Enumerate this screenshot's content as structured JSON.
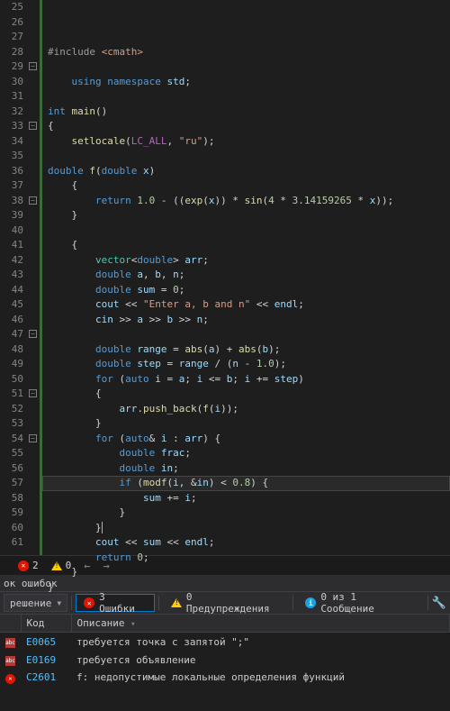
{
  "editor": {
    "first_line": 25,
    "lines": [
      {
        "n": 25,
        "seg": [
          {
            "c": "tok-pp",
            "t": "#include "
          },
          {
            "c": "tok-str",
            "t": "<cmath>"
          }
        ]
      },
      {
        "n": 26,
        "seg": []
      },
      {
        "n": 27,
        "seg": [
          {
            "c": "tok-kw",
            "t": "    using "
          },
          {
            "c": "tok-kw",
            "t": "namespace "
          },
          {
            "c": "tok-var",
            "t": "std"
          },
          {
            "c": "",
            "t": ";"
          }
        ]
      },
      {
        "n": 28,
        "seg": []
      },
      {
        "n": 29,
        "fold": "-",
        "seg": [
          {
            "c": "tok-type",
            "t": "int "
          },
          {
            "c": "tok-fn",
            "t": "main"
          },
          {
            "c": "",
            "t": "()"
          }
        ]
      },
      {
        "n": 30,
        "seg": [
          {
            "c": "",
            "t": "{"
          }
        ]
      },
      {
        "n": 31,
        "seg": [
          {
            "c": "",
            "t": "    "
          },
          {
            "c": "tok-fn",
            "t": "setlocale"
          },
          {
            "c": "",
            "t": "("
          },
          {
            "c": "tok-mac",
            "t": "LC_ALL"
          },
          {
            "c": "",
            "t": ", "
          },
          {
            "c": "tok-str",
            "t": "\"ru\""
          },
          {
            "c": "",
            "t": ");"
          }
        ]
      },
      {
        "n": 32,
        "seg": []
      },
      {
        "n": 33,
        "fold": "-",
        "seg": [
          {
            "c": "tok-type",
            "t": "double "
          },
          {
            "c": "tok-fn",
            "t": "f"
          },
          {
            "c": "",
            "t": "("
          },
          {
            "c": "tok-type",
            "t": "double "
          },
          {
            "c": "tok-var",
            "t": "x"
          },
          {
            "c": "",
            "t": ")"
          }
        ]
      },
      {
        "n": 34,
        "seg": [
          {
            "c": "",
            "t": "    {"
          }
        ]
      },
      {
        "n": 35,
        "seg": [
          {
            "c": "",
            "t": "        "
          },
          {
            "c": "tok-kw",
            "t": "return "
          },
          {
            "c": "tok-num",
            "t": "1.0"
          },
          {
            "c": "",
            "t": " - (("
          },
          {
            "c": "tok-fn",
            "t": "exp"
          },
          {
            "c": "",
            "t": "("
          },
          {
            "c": "tok-var",
            "t": "x"
          },
          {
            "c": "",
            "t": ")) * "
          },
          {
            "c": "tok-fn",
            "t": "sin"
          },
          {
            "c": "",
            "t": "("
          },
          {
            "c": "tok-num",
            "t": "4"
          },
          {
            "c": "",
            "t": " * "
          },
          {
            "c": "tok-num",
            "t": "3.14159265"
          },
          {
            "c": "",
            "t": " * "
          },
          {
            "c": "tok-var",
            "t": "x"
          },
          {
            "c": "",
            "t": "));"
          }
        ]
      },
      {
        "n": 36,
        "seg": [
          {
            "c": "",
            "t": "    }"
          }
        ]
      },
      {
        "n": 37,
        "seg": []
      },
      {
        "n": 38,
        "fold": "-",
        "seg": [
          {
            "c": "",
            "t": "    {"
          }
        ]
      },
      {
        "n": 39,
        "seg": [
          {
            "c": "",
            "t": "        "
          },
          {
            "c": "tok-utype",
            "t": "vector"
          },
          {
            "c": "",
            "t": "<"
          },
          {
            "c": "tok-type",
            "t": "double"
          },
          {
            "c": "",
            "t": "> "
          },
          {
            "c": "tok-var",
            "t": "arr"
          },
          {
            "c": "",
            "t": ";"
          }
        ]
      },
      {
        "n": 40,
        "seg": [
          {
            "c": "",
            "t": "        "
          },
          {
            "c": "tok-type",
            "t": "double "
          },
          {
            "c": "tok-var",
            "t": "a"
          },
          {
            "c": "",
            "t": ", "
          },
          {
            "c": "tok-var",
            "t": "b"
          },
          {
            "c": "",
            "t": ", "
          },
          {
            "c": "tok-var",
            "t": "n"
          },
          {
            "c": "",
            "t": ";"
          }
        ]
      },
      {
        "n": 41,
        "seg": [
          {
            "c": "",
            "t": "        "
          },
          {
            "c": "tok-type",
            "t": "double "
          },
          {
            "c": "tok-var",
            "t": "sum"
          },
          {
            "c": "",
            "t": " = "
          },
          {
            "c": "tok-num",
            "t": "0"
          },
          {
            "c": "",
            "t": ";"
          }
        ]
      },
      {
        "n": 42,
        "seg": [
          {
            "c": "",
            "t": "        "
          },
          {
            "c": "tok-var",
            "t": "cout"
          },
          {
            "c": "",
            "t": " << "
          },
          {
            "c": "tok-str",
            "t": "\"Enter a, b and n\""
          },
          {
            "c": "",
            "t": " << "
          },
          {
            "c": "tok-var",
            "t": "endl"
          },
          {
            "c": "",
            "t": ";"
          }
        ]
      },
      {
        "n": 43,
        "seg": [
          {
            "c": "",
            "t": "        "
          },
          {
            "c": "tok-var",
            "t": "cin"
          },
          {
            "c": "",
            "t": " >> "
          },
          {
            "c": "tok-var",
            "t": "a"
          },
          {
            "c": "",
            "t": " >> "
          },
          {
            "c": "tok-var",
            "t": "b"
          },
          {
            "c": "",
            "t": " >> "
          },
          {
            "c": "tok-var",
            "t": "n"
          },
          {
            "c": "",
            "t": ";"
          }
        ]
      },
      {
        "n": 44,
        "seg": []
      },
      {
        "n": 45,
        "seg": [
          {
            "c": "",
            "t": "        "
          },
          {
            "c": "tok-type",
            "t": "double "
          },
          {
            "c": "tok-var",
            "t": "range"
          },
          {
            "c": "",
            "t": " = "
          },
          {
            "c": "tok-fn",
            "t": "abs"
          },
          {
            "c": "",
            "t": "("
          },
          {
            "c": "tok-var",
            "t": "a"
          },
          {
            "c": "",
            "t": ") + "
          },
          {
            "c": "tok-fn",
            "t": "abs"
          },
          {
            "c": "",
            "t": "("
          },
          {
            "c": "tok-var",
            "t": "b"
          },
          {
            "c": "",
            "t": ");"
          }
        ]
      },
      {
        "n": 46,
        "seg": [
          {
            "c": "",
            "t": "        "
          },
          {
            "c": "tok-type",
            "t": "double "
          },
          {
            "c": "tok-var",
            "t": "step"
          },
          {
            "c": "",
            "t": " = "
          },
          {
            "c": "tok-var",
            "t": "range"
          },
          {
            "c": "",
            "t": " / ("
          },
          {
            "c": "tok-var",
            "t": "n"
          },
          {
            "c": "",
            "t": " - "
          },
          {
            "c": "tok-num",
            "t": "1.0"
          },
          {
            "c": "",
            "t": ");"
          }
        ]
      },
      {
        "n": 47,
        "fold": "-",
        "seg": [
          {
            "c": "",
            "t": "        "
          },
          {
            "c": "tok-kw",
            "t": "for "
          },
          {
            "c": "",
            "t": "("
          },
          {
            "c": "tok-kw",
            "t": "auto "
          },
          {
            "c": "tok-var",
            "t": "i"
          },
          {
            "c": "",
            "t": " = "
          },
          {
            "c": "tok-var",
            "t": "a"
          },
          {
            "c": "",
            "t": "; "
          },
          {
            "c": "tok-var",
            "t": "i"
          },
          {
            "c": "",
            "t": " <= "
          },
          {
            "c": "tok-var",
            "t": "b"
          },
          {
            "c": "",
            "t": "; "
          },
          {
            "c": "tok-var",
            "t": "i"
          },
          {
            "c": "",
            "t": " += "
          },
          {
            "c": "tok-var",
            "t": "step"
          },
          {
            "c": "",
            "t": ")"
          }
        ]
      },
      {
        "n": 48,
        "seg": [
          {
            "c": "",
            "t": "        {"
          }
        ]
      },
      {
        "n": 49,
        "seg": [
          {
            "c": "",
            "t": "            "
          },
          {
            "c": "tok-var",
            "t": "arr"
          },
          {
            "c": "",
            "t": "."
          },
          {
            "c": "tok-fn",
            "t": "push_back"
          },
          {
            "c": "",
            "t": "("
          },
          {
            "c": "tok-fn",
            "t": "f"
          },
          {
            "c": "",
            "t": "("
          },
          {
            "c": "tok-var",
            "t": "i"
          },
          {
            "c": "",
            "t": "));"
          }
        ]
      },
      {
        "n": 50,
        "seg": [
          {
            "c": "",
            "t": "        }"
          }
        ]
      },
      {
        "n": 51,
        "fold": "-",
        "seg": [
          {
            "c": "",
            "t": "        "
          },
          {
            "c": "tok-kw",
            "t": "for "
          },
          {
            "c": "",
            "t": "("
          },
          {
            "c": "tok-kw",
            "t": "auto"
          },
          {
            "c": "",
            "t": "& "
          },
          {
            "c": "tok-var",
            "t": "i"
          },
          {
            "c": "",
            "t": " : "
          },
          {
            "c": "tok-var",
            "t": "arr"
          },
          {
            "c": "",
            "t": ") {"
          }
        ]
      },
      {
        "n": 52,
        "seg": [
          {
            "c": "",
            "t": "            "
          },
          {
            "c": "tok-type",
            "t": "double "
          },
          {
            "c": "tok-var",
            "t": "frac"
          },
          {
            "c": "",
            "t": ";"
          }
        ]
      },
      {
        "n": 53,
        "seg": [
          {
            "c": "",
            "t": "            "
          },
          {
            "c": "tok-type",
            "t": "double "
          },
          {
            "c": "tok-var",
            "t": "in"
          },
          {
            "c": "",
            "t": ";"
          }
        ]
      },
      {
        "n": 54,
        "fold": "-",
        "seg": [
          {
            "c": "",
            "t": "            "
          },
          {
            "c": "tok-kw",
            "t": "if "
          },
          {
            "c": "",
            "t": "("
          },
          {
            "c": "tok-fn",
            "t": "modf"
          },
          {
            "c": "",
            "t": "("
          },
          {
            "c": "tok-var",
            "t": "i"
          },
          {
            "c": "",
            "t": ", &"
          },
          {
            "c": "tok-var",
            "t": "in"
          },
          {
            "c": "",
            "t": ") < "
          },
          {
            "c": "tok-num",
            "t": "0.8"
          },
          {
            "c": "",
            "t": ") {"
          }
        ]
      },
      {
        "n": 55,
        "seg": [
          {
            "c": "",
            "t": "                "
          },
          {
            "c": "tok-var",
            "t": "sum"
          },
          {
            "c": "",
            "t": " += "
          },
          {
            "c": "tok-var",
            "t": "i"
          },
          {
            "c": "",
            "t": ";"
          }
        ]
      },
      {
        "n": 56,
        "seg": [
          {
            "c": "",
            "t": "            }"
          }
        ]
      },
      {
        "n": 57,
        "caret": true,
        "seg": [
          {
            "c": "",
            "t": "        }"
          }
        ]
      },
      {
        "n": 58,
        "seg": [
          {
            "c": "",
            "t": "        "
          },
          {
            "c": "tok-var",
            "t": "cout"
          },
          {
            "c": "",
            "t": " << "
          },
          {
            "c": "tok-var",
            "t": "sum"
          },
          {
            "c": "",
            "t": " << "
          },
          {
            "c": "tok-var",
            "t": "endl"
          },
          {
            "c": "",
            "t": ";"
          }
        ]
      },
      {
        "n": 59,
        "seg": [
          {
            "c": "",
            "t": "        "
          },
          {
            "c": "tok-kw",
            "t": "return "
          },
          {
            "c": "tok-num",
            "t": "0"
          },
          {
            "c": "",
            "t": ";"
          }
        ]
      },
      {
        "n": 60,
        "seg": [
          {
            "c": "",
            "t": "    }"
          }
        ]
      },
      {
        "n": 61,
        "seg": [
          {
            "c": "",
            "t": "}"
          }
        ]
      }
    ]
  },
  "status": {
    "err_count": "2",
    "warn_count": "0"
  },
  "errlist": {
    "title": "ок ошибок",
    "scope": "решение",
    "errors_pill": "3 Ошибки",
    "warnings_pill": "0 Предупреждения",
    "messages_pill": "0 из 1 Сообщение",
    "cols": {
      "code": "Код",
      "desc": "Описание"
    },
    "rows": [
      {
        "icon": "abc",
        "code": "E0065",
        "desc": "требуется точка с запятой \";\""
      },
      {
        "icon": "abc",
        "code": "E0169",
        "desc": "требуется объявление"
      },
      {
        "icon": "err",
        "code": "C2601",
        "desc": "f: недопустимые локальные определения функций"
      }
    ]
  }
}
